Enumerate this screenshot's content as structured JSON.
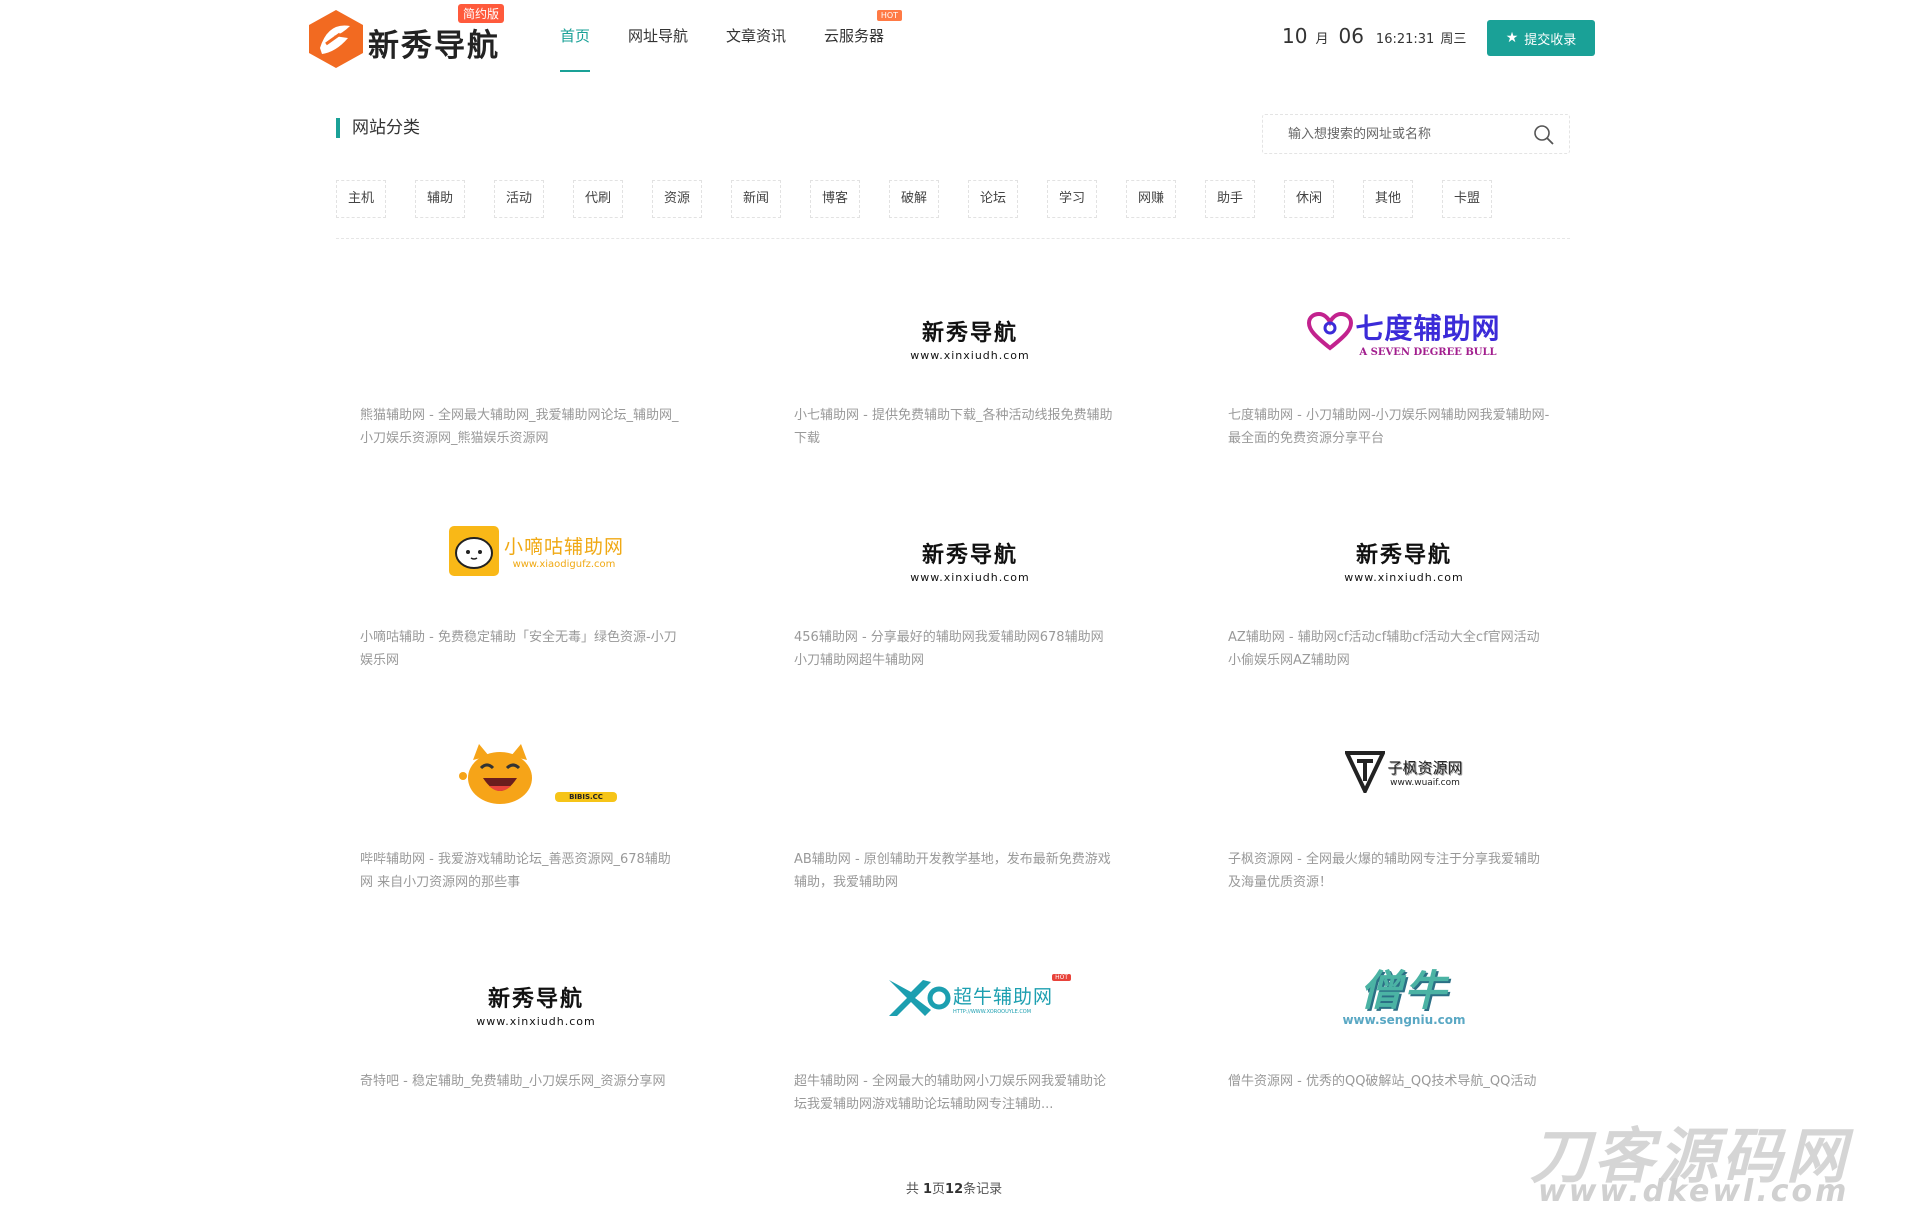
{
  "header": {
    "logo_text": "新秀导航",
    "logo_badge": "简约版",
    "nav": [
      {
        "label": "首页",
        "active": true
      },
      {
        "label": "网址导航"
      },
      {
        "label": "文章资讯"
      },
      {
        "label": "云服务器",
        "badge": "HOT"
      }
    ],
    "datetime": {
      "month": "10",
      "month_unit": "月",
      "day": "06",
      "time": "16:21:31",
      "weekday": "周三"
    },
    "submit_label": "提交收录"
  },
  "categories": {
    "title": "网站分类",
    "search_placeholder": "输入想搜索的网址或名称",
    "tags": [
      "主机",
      "辅助",
      "活动",
      "代刷",
      "资源",
      "新闻",
      "博客",
      "破解",
      "论坛",
      "学习",
      "网赚",
      "助手",
      "休闲",
      "其他",
      "卡盟"
    ]
  },
  "cards": [
    {
      "logo": "none",
      "desc": "熊猫辅助网 - 全网最大辅助网_我爱辅助网论坛_辅助网_小刀娱乐资源网_熊猫娱乐资源网"
    },
    {
      "logo": "xinxiu",
      "logo_cn": "新秀导航",
      "logo_en": "www.xinxiudh.com",
      "desc": "小七辅助网 - 提供免费辅助下载_各种活动线报免费辅助下载"
    },
    {
      "logo": "qidu",
      "logo_cn": "七度辅助网",
      "logo_en": "A SEVEN DEGREE BULL",
      "desc": "七度辅助网 - 小刀辅助网-小刀娱乐网辅助网我爱辅助网-最全面的免费资源分享平台"
    },
    {
      "logo": "xiaodigu",
      "logo_cn": "小嘀咕辅助网",
      "logo_en": "www.xiaodigufz.com",
      "desc": "小嘀咕辅助 - 免费稳定辅助「安全无毒」绿色资源-小刀娱乐网"
    },
    {
      "logo": "xinxiu",
      "logo_cn": "新秀导航",
      "logo_en": "www.xinxiudh.com",
      "desc": "456辅助网 - 分享最好的辅助网我爱辅助网678辅助网小刀辅助网超牛辅助网"
    },
    {
      "logo": "xinxiu",
      "logo_cn": "新秀导航",
      "logo_en": "www.xinxiudh.com",
      "desc": "AZ辅助网 - 辅助网cf活动cf辅助cf活动大全cf官网活动小偷娱乐网AZ辅助网"
    },
    {
      "logo": "bibis",
      "logo_en": "BIBIS.CC",
      "desc": "哔哔辅助网 - 我爱游戏辅助论坛_善恶资源网_678辅助网 来自小刀资源网的那些事"
    },
    {
      "logo": "none",
      "desc": "AB辅助网 - 原创辅助开发教学基地，发布最新免费游戏辅助，我爱辅助网"
    },
    {
      "logo": "zifeng",
      "logo_cn": "子枫资源网",
      "logo_en": "www.wuaif.com",
      "desc": "子枫资源网 - 全网最火爆的辅助网专注于分享我爱辅助及海量优质资源！"
    },
    {
      "logo": "xinxiu",
      "logo_cn": "新秀导航",
      "logo_en": "www.xinxiudh.com",
      "desc": "奇特吧 - 稳定辅助_免费辅助_小刀娱乐网_资源分享网"
    },
    {
      "logo": "chaoniu",
      "logo_cn": "超牛辅助网",
      "logo_en": "HTTP://WWW.XOROOUYLE.COM",
      "logo_badge": "HOT",
      "desc": "超牛辅助网 - 全网最大的辅助网小刀娱乐网我爱辅助论坛我爱辅助网游戏辅助论坛辅助网专注辅助..."
    },
    {
      "logo": "sengniu",
      "logo_cn": "僧牛",
      "logo_en": "www.sengniu.com",
      "desc": "僧牛资源网 - 优秀的QQ破解站_QQ技术导航_QQ活动"
    }
  ],
  "pagination": {
    "prefix": "共 ",
    "pages": "1",
    "middle": "页",
    "records": "12",
    "suffix": "条记录"
  },
  "watermark": {
    "cn": "刀客源码网",
    "en": "www.dkewl.com"
  },
  "colors": {
    "accent": "#1aa197",
    "hot": "#ff7a45",
    "logo_orange": "#f26a21"
  }
}
